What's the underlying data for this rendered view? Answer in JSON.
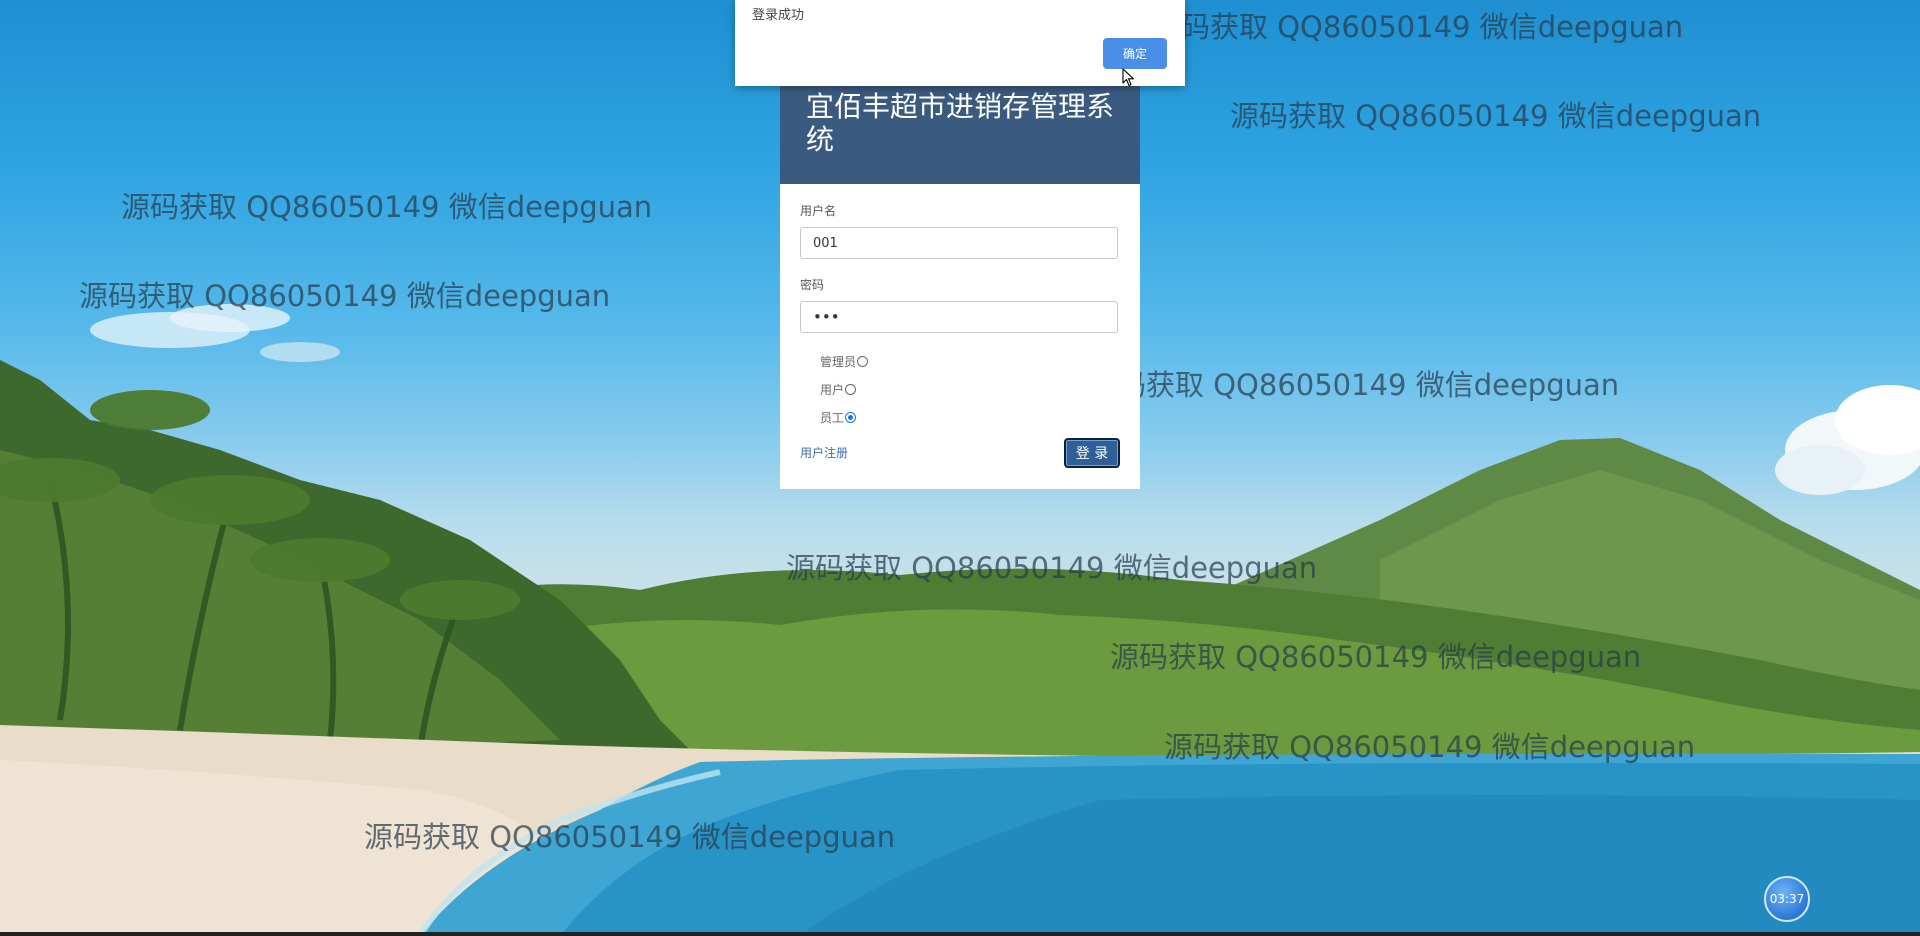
{
  "dialog": {
    "message": "登录成功",
    "ok_label": "确定"
  },
  "login": {
    "title": "宜佰丰超市进销存管理系统",
    "username_label": "用户名",
    "username_value": "001",
    "password_label": "密码",
    "password_value": "•••",
    "roles": [
      {
        "label": "管理员",
        "selected": false
      },
      {
        "label": "用户",
        "selected": false
      },
      {
        "label": "员工",
        "selected": true
      }
    ],
    "register_link": "用户注册",
    "submit_label": "登 录"
  },
  "watermark": {
    "text": "源码获取 QQ86050149 微信deepguan"
  },
  "timer": {
    "label": "03:37"
  },
  "colors": {
    "card_header": "#3a5a80",
    "login_button": "#2f5f96",
    "ok_button": "#4a8fe7",
    "radio_selected": "#1a73e8"
  }
}
